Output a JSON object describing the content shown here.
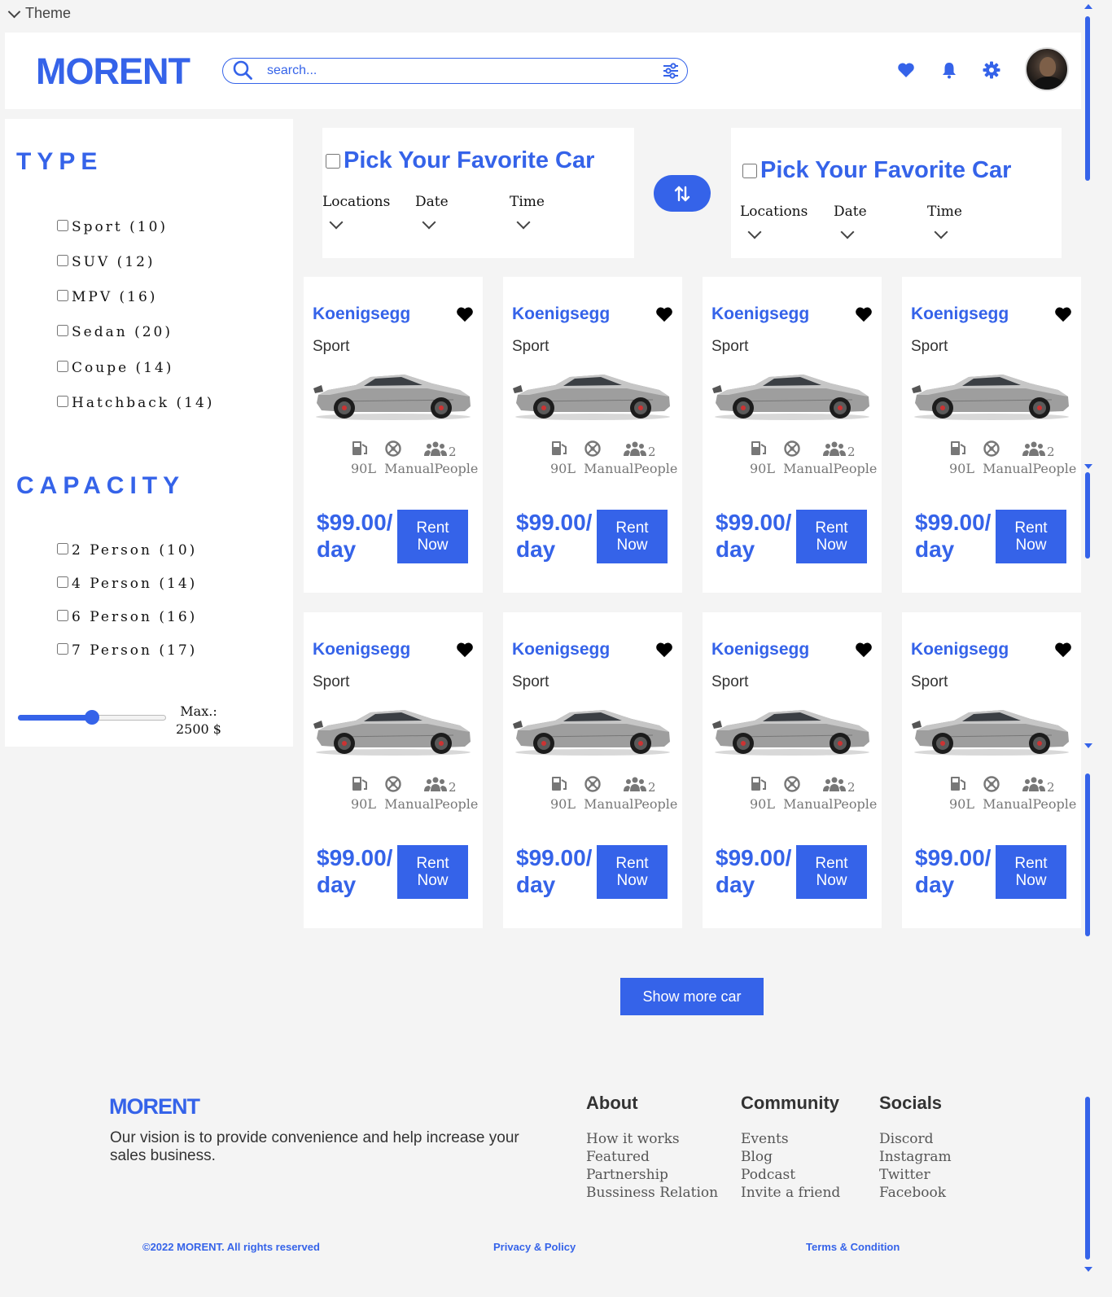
{
  "theme_toggle": {
    "label": "Theme"
  },
  "header": {
    "logo": "MORENT",
    "search_placeholder": "search...",
    "icons": [
      "heart-icon",
      "bell-icon",
      "gear-icon"
    ]
  },
  "sidebar": {
    "type_title": "TYPE",
    "types": [
      {
        "label": "Sport (10)"
      },
      {
        "label": "SUV (12)"
      },
      {
        "label": "MPV (16)"
      },
      {
        "label": "Sedan (20)"
      },
      {
        "label": "Coupe (14)"
      },
      {
        "label": "Hatchback (14)"
      }
    ],
    "capacity_title": "CAPACITY",
    "capacities": [
      {
        "label": "2 Person (10)"
      },
      {
        "label": "4 Person (14)"
      },
      {
        "label": "6 Person (16)"
      },
      {
        "label": "7 Person (17)"
      }
    ],
    "price_slider": {
      "value_fraction": 0.5
    },
    "max_label": "Max.:",
    "max_value": "2500 $"
  },
  "pick": [
    {
      "title": "Pick Your Favorite Car",
      "locations": "Locations",
      "date": "Date",
      "time": "Time"
    },
    {
      "title": "Pick Your Favorite Car",
      "locations": "Locations",
      "date": "Date",
      "time": "Time"
    }
  ],
  "cards": [
    {
      "name": "Koenigsegg",
      "type": "Sport",
      "fuel": "90L",
      "transmission": "Manual",
      "people_label": "People",
      "people_count": "2",
      "price_line1": "$99.00/",
      "price_line2": "day",
      "rent_line1": "Rent",
      "rent_line2": "Now"
    },
    {
      "name": "Koenigsegg",
      "type": "Sport",
      "fuel": "90L",
      "transmission": "Manual",
      "people_label": "People",
      "people_count": "2",
      "price_line1": "$99.00/",
      "price_line2": "day",
      "rent_line1": "Rent",
      "rent_line2": "Now"
    },
    {
      "name": "Koenigsegg",
      "type": "Sport",
      "fuel": "90L",
      "transmission": "Manual",
      "people_label": "People",
      "people_count": "2",
      "price_line1": "$99.00/",
      "price_line2": "day",
      "rent_line1": "Rent",
      "rent_line2": "Now"
    },
    {
      "name": "Koenigsegg",
      "type": "Sport",
      "fuel": "90L",
      "transmission": "Manual",
      "people_label": "People",
      "people_count": "2",
      "price_line1": "$99.00/",
      "price_line2": "day",
      "rent_line1": "Rent",
      "rent_line2": "Now"
    },
    {
      "name": "Koenigsegg",
      "type": "Sport",
      "fuel": "90L",
      "transmission": "Manual",
      "people_label": "People",
      "people_count": "2",
      "price_line1": "$99.00/",
      "price_line2": "day",
      "rent_line1": "Rent",
      "rent_line2": "Now"
    },
    {
      "name": "Koenigsegg",
      "type": "Sport",
      "fuel": "90L",
      "transmission": "Manual",
      "people_label": "People",
      "people_count": "2",
      "price_line1": "$99.00/",
      "price_line2": "day",
      "rent_line1": "Rent",
      "rent_line2": "Now"
    },
    {
      "name": "Koenigsegg",
      "type": "Sport",
      "fuel": "90L",
      "transmission": "Manual",
      "people_label": "People",
      "people_count": "2",
      "price_line1": "$99.00/",
      "price_line2": "day",
      "rent_line1": "Rent",
      "rent_line2": "Now"
    },
    {
      "name": "Koenigsegg",
      "type": "Sport",
      "fuel": "90L",
      "transmission": "Manual",
      "people_label": "People",
      "people_count": "2",
      "price_line1": "$99.00/",
      "price_line2": "day",
      "rent_line1": "Rent",
      "rent_line2": "Now"
    }
  ],
  "show_more": "Show more car",
  "footer": {
    "logo": "MORENT",
    "description": "Our vision is to provide convenience and help increase your sales business.",
    "columns": [
      {
        "title": "About",
        "links": [
          "How it works",
          "Featured",
          "Partnership",
          "Bussiness Relation"
        ]
      },
      {
        "title": "Community",
        "links": [
          "Events",
          "Blog",
          "Podcast",
          "Invite a friend"
        ]
      },
      {
        "title": "Socials",
        "links": [
          "Discord",
          "Instagram",
          "Twitter",
          "Facebook"
        ]
      }
    ],
    "copyright": "©2022 MORENT. All rights reserved",
    "privacy": "Privacy & Policy",
    "terms": "Terms & Condition"
  },
  "colors": {
    "accent": "#3563e9",
    "background": "#f4f4f4",
    "card": "#ffffff"
  }
}
